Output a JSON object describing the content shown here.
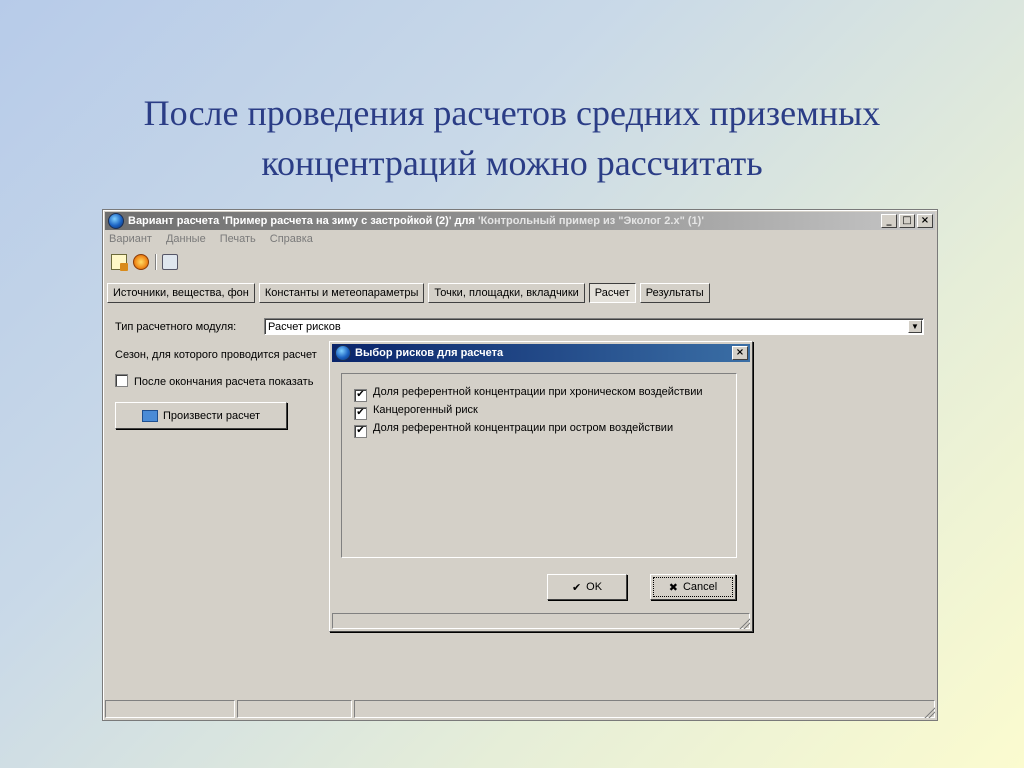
{
  "slide": {
    "title_line1": "После проведения расчетов средних приземных",
    "title_line2": "концентраций можно рассчитать"
  },
  "window": {
    "title_main": "Вариант расчета 'Пример расчета на зиму с застройкой (2)' для",
    "title_rest": "'Контрольный пример из \"Эколог 2.х\" (1)'",
    "buttons": {
      "minimize": "_",
      "maximize": "□",
      "close": "×"
    },
    "menu": [
      "Вариант",
      "Данные",
      "Печать",
      "Справка"
    ],
    "toolbar_icons": [
      "document-icon",
      "run-icon",
      "print-icon"
    ],
    "tabs": [
      {
        "label": "Источники, вещества, фон",
        "active": false
      },
      {
        "label": "Константы и метеопараметры",
        "active": false
      },
      {
        "label": "Точки, площадки, вкладчики",
        "active": false
      },
      {
        "label": "Расчет",
        "active": true
      },
      {
        "label": "Результаты",
        "active": false
      }
    ],
    "module_type_label": "Тип расчетного модуля:",
    "module_type_value": "Расчет рисков",
    "season_label": "Сезон, для которого проводится расчет",
    "after_calc_label": "После окончания расчета показать",
    "after_calc_checked": false,
    "run_button_label": "Произвести расчет"
  },
  "dialog": {
    "title": "Выбор рисков для расчета",
    "close": "×",
    "options": [
      {
        "label": "Доля референтной концентрации при хроническом воздействии",
        "checked": true
      },
      {
        "label": "Канцерогенный риск",
        "checked": true
      },
      {
        "label": "Доля референтной концентрации при остром воздействии",
        "checked": true
      }
    ],
    "ok_label": "OK",
    "cancel_label": "Cancel"
  }
}
